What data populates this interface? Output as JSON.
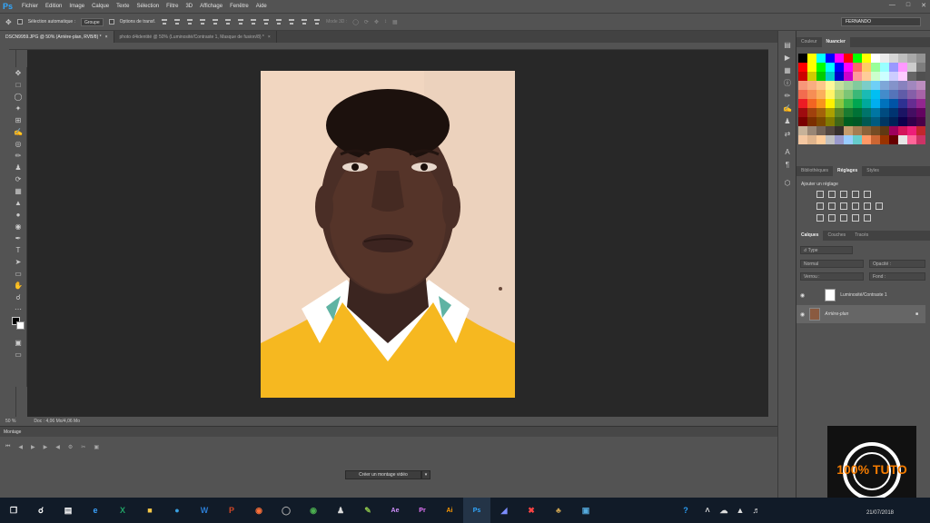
{
  "menubar": {
    "logo": "Ps",
    "items": [
      "Fichier",
      "Edition",
      "Image",
      "Calque",
      "Texte",
      "Sélection",
      "Filtre",
      "3D",
      "Affichage",
      "Fenêtre",
      "Aide"
    ]
  },
  "options": {
    "auto_select_label": "Sélection automatique :",
    "group_value": "Groupe",
    "transform_label": "Options de transf.",
    "mode3d_label": "Mode 3D :",
    "workspace": "FERNANDO"
  },
  "tabs": [
    {
      "label": "DSCN9959.JPG @ 50% (Arrière-plan, RVB/8) *",
      "close": "×"
    },
    {
      "label": "photo d4identité @ 50% (Luminosité/Contraste 1, Masque de fusion/8) *",
      "close": "×"
    }
  ],
  "status": {
    "zoom": "50 %",
    "doc": "Doc : 4,06 Mo/4,06 Mo"
  },
  "timeline": {
    "title": "Montage",
    "create_video": "Créer un montage vidéo"
  },
  "panels": {
    "swatch_tabs": [
      "Couleur",
      "Nuancier"
    ],
    "adjust_tabs": [
      "Bibliothèques",
      "Réglages",
      "Styles"
    ],
    "adjust_title": "Ajouter un réglage",
    "layer_tabs": [
      "Calques",
      "Couches",
      "Tracés"
    ],
    "kind": "Type",
    "blend": "Normal",
    "opacity_label": "Opacité :",
    "lock_label": "Verrou :",
    "fill_label": "Fond :",
    "layers": [
      {
        "name": "Luminosité/Contraste 1"
      },
      {
        "name": "Arrière-plan"
      }
    ]
  },
  "logo": {
    "text": "100% TUTO"
  },
  "taskbar": {
    "date": "21/07/2018"
  },
  "colors": {
    "swatches": [
      "#000000",
      "#ffff00",
      "#00ffff",
      "#0000ff",
      "#ff00ff",
      "#ff0000",
      "#00ff00",
      "#ffff00",
      "#ffffff",
      "#ececec",
      "#d6d6d6",
      "#bfbfbf",
      "#a9a9a9",
      "#939393",
      "#ff0000",
      "#ffff00",
      "#00ff00",
      "#00ffff",
      "#0000ff",
      "#ff00ff",
      "#ff6666",
      "#ffcc66",
      "#99ff99",
      "#99ffff",
      "#9999ff",
      "#ff99ff",
      "#cccccc",
      "#7d7d7d",
      "#cc0000",
      "#cccc00",
      "#00cc00",
      "#00cccc",
      "#0000cc",
      "#cc00cc",
      "#ff9999",
      "#ffcc99",
      "#ccffcc",
      "#ccffff",
      "#ccccff",
      "#ffccff",
      "#666666",
      "#505050",
      "#f7977a",
      "#f9ad81",
      "#fdc68a",
      "#fff79a",
      "#c4df9b",
      "#a2d39c",
      "#82ca9d",
      "#7bcdc8",
      "#6ecff6",
      "#7ea7d8",
      "#8493ca",
      "#8882be",
      "#a187be",
      "#bc8dbf",
      "#f26c4f",
      "#f68e55",
      "#fbaf5c",
      "#fff467",
      "#acd372",
      "#7cc576",
      "#3bb878",
      "#1abbb4",
      "#00bff3",
      "#438ccb",
      "#5574b9",
      "#605ca8",
      "#855fa8",
      "#a763a8",
      "#ed1c24",
      "#f26522",
      "#f7941d",
      "#fff200",
      "#8dc73f",
      "#39b54a",
      "#00a651",
      "#00a99d",
      "#00aeef",
      "#0072bc",
      "#0054a6",
      "#2e3192",
      "#662d91",
      "#92278f",
      "#9e0b0f",
      "#a0410d",
      "#a3620a",
      "#aba000",
      "#598527",
      "#1a7b30",
      "#007236",
      "#00746b",
      "#0076a3",
      "#004b80",
      "#003471",
      "#1b1464",
      "#440e62",
      "#630460",
      "#790000",
      "#7b2e00",
      "#7d4900",
      "#827b00",
      "#406618",
      "#005e20",
      "#005826",
      "#005952",
      "#005b7f",
      "#003663",
      "#002157",
      "#0d004c",
      "#32004b",
      "#4b0049",
      "#c7b299",
      "#998675",
      "#736357",
      "#534741",
      "#37302d",
      "#c69c6d",
      "#a67c52",
      "#8c6239",
      "#754c24",
      "#603913",
      "#9e005d",
      "#d4145a",
      "#ed1e79",
      "#c1272d",
      "#f4c7a1",
      "#e0b48c",
      "#ffcc99",
      "#c0c0c0",
      "#9999cc",
      "#99ccff",
      "#66cccc",
      "#ff9966",
      "#cc6633",
      "#993300",
      "#660000",
      "#e6e6e6",
      "#ff6699",
      "#cc3366"
    ]
  }
}
